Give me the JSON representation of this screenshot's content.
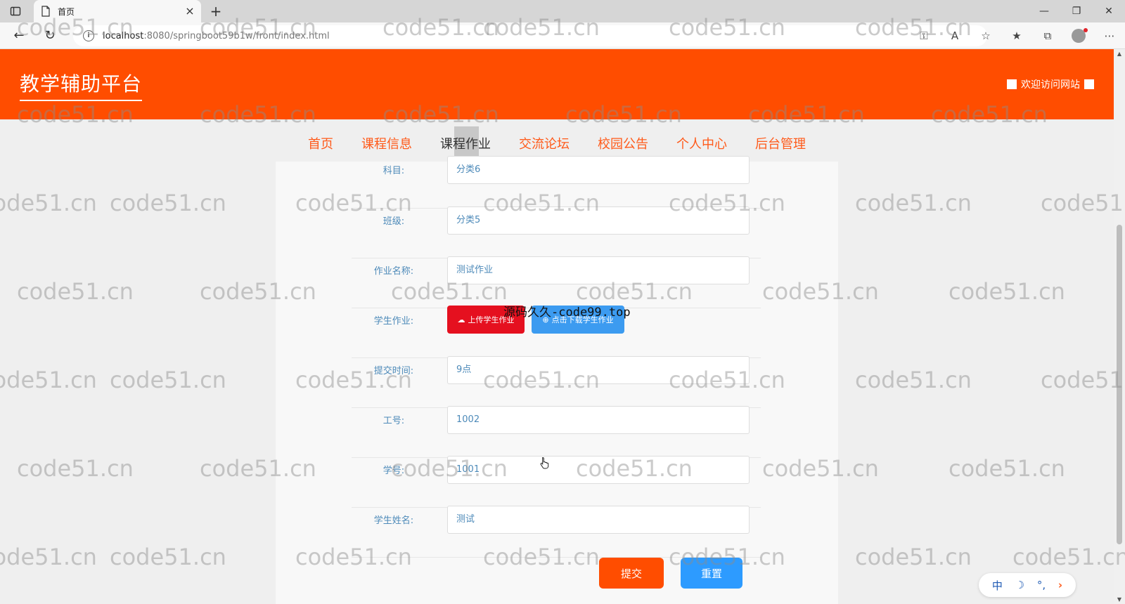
{
  "browser": {
    "tab_title": "首页",
    "url_host": "localhost",
    "url_rest": ":8080/springboot59b1w/front/index.html"
  },
  "header": {
    "site_title": "教学辅助平台",
    "welcome": "欢迎访问网站"
  },
  "nav": {
    "items": [
      {
        "label": "首页"
      },
      {
        "label": "课程信息"
      },
      {
        "label": "课程作业"
      },
      {
        "label": "交流论坛"
      },
      {
        "label": "校园公告"
      },
      {
        "label": "个人中心"
      },
      {
        "label": "后台管理"
      }
    ]
  },
  "form": {
    "subject": {
      "label": "科目:",
      "value": "分类6"
    },
    "class": {
      "label": "班级:",
      "value": "分类5"
    },
    "homework_name": {
      "label": "作业名称:",
      "value": "测试作业"
    },
    "student_homework": {
      "label": "学生作业:",
      "upload_label": "上传学生作业",
      "download_label": "点击下载学生作业"
    },
    "submit_time": {
      "label": "提交时间:",
      "value": "9点"
    },
    "work_id": {
      "label": "工号:",
      "value": "1002"
    },
    "student_id": {
      "label": "学号:",
      "value": "1001"
    },
    "student_name": {
      "label": "学生姓名:",
      "value": "测试"
    },
    "submit_label": "提交",
    "reset_label": "重置"
  },
  "overlay_text": "源码久久-code99.top",
  "watermark_text": "code51.cn",
  "ime": {
    "lang": "中",
    "moon": "☽",
    "punct": "°,",
    "arrow": "›"
  },
  "colors": {
    "brand": "#ff4d00",
    "nav_text": "#ff5a1a",
    "blue_button": "#2d9bff",
    "red_button": "#e5101f"
  }
}
